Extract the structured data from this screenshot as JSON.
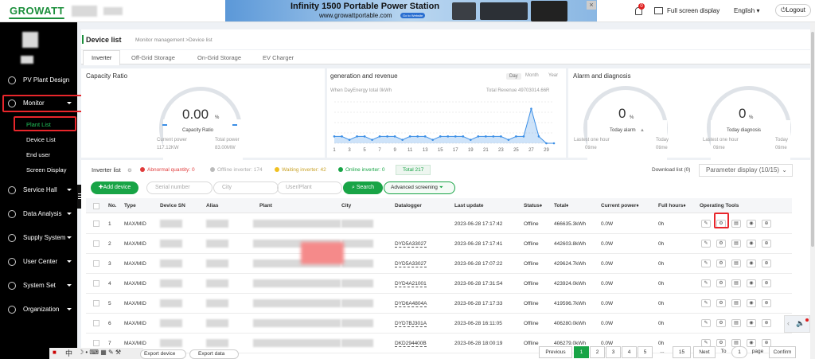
{
  "header": {
    "logo": "GROWATT",
    "ad": {
      "title": "Infinity 1500 Portable Power Station",
      "url": "www.growattportable.com",
      "button": "Go to Website"
    },
    "notification_count": "0",
    "fullscreen_label": "Full screen display",
    "language": "English",
    "logout_label": "Logout"
  },
  "sidebar": {
    "items": [
      {
        "label": "PV Plant Design"
      },
      {
        "label": "Monitor"
      },
      {
        "label": "Service Hall"
      },
      {
        "label": "Data Analysis"
      },
      {
        "label": "Supply System"
      },
      {
        "label": "User Center"
      },
      {
        "label": "System Set"
      },
      {
        "label": "Organization"
      }
    ],
    "monitor_sub": [
      "Plant List",
      "Device List",
      "End user",
      "Screen Display"
    ]
  },
  "page": {
    "title": "Device list",
    "breadcrumb": "Monitor management >Device list",
    "tabs": [
      "Inverter",
      "Off-Grid Storage",
      "On-Grid Storage",
      "EV Charger"
    ]
  },
  "capacity": {
    "title": "Capacity Ratio",
    "value": "0.00",
    "unit": "%",
    "label": "Capacity Ratio",
    "current_power_label": "Current power",
    "current_power_value": "117.12KW",
    "total_power_label": "Total power",
    "total_power_value": "83.00MW"
  },
  "revenue": {
    "title": "generation and revenue",
    "segments": [
      "Day",
      "Month",
      "Year"
    ],
    "subtitle": "When DayEnergy total 0kWh",
    "total_revenue": "Total Revenue 49703014.66R"
  },
  "chart_data": {
    "type": "area",
    "x": [
      1,
      2,
      3,
      4,
      5,
      6,
      7,
      8,
      9,
      10,
      11,
      12,
      13,
      14,
      15,
      16,
      17,
      18,
      19,
      20,
      21,
      22,
      23,
      24,
      25,
      26,
      27,
      28,
      29,
      30
    ],
    "values": [
      2,
      2,
      1,
      2,
      2,
      1,
      2,
      2,
      2,
      1,
      2,
      2,
      2,
      1,
      2,
      2,
      2,
      2,
      1,
      2,
      2,
      2,
      2,
      1,
      2,
      2,
      10,
      2,
      0,
      0
    ],
    "x_tick_labels": [
      "1",
      "3",
      "5",
      "7",
      "9",
      "11",
      "13",
      "15",
      "17",
      "19",
      "21",
      "23",
      "25",
      "27",
      "29"
    ],
    "xlim": [
      1,
      30
    ],
    "ylim": [
      0,
      12
    ],
    "color": "#3a8ee6",
    "grid": true
  },
  "alarm": {
    "title": "Alarm and diagnosis",
    "alarm_value": "0",
    "alarm_unit": "%",
    "alarm_label": "Today alarm",
    "diag_value": "0",
    "diag_unit": "%",
    "diag_label": "Today diagnosis",
    "hour_label": "Lastest one hour",
    "today_label": "Today",
    "time_a": "0time",
    "time_b": "0time",
    "time_c": "0time",
    "time_d": "0time"
  },
  "list": {
    "title": "Inverter list",
    "abnormal": "Abnormal quantity: 0",
    "offline": "Offline inverter: 174",
    "waiting": "Waiting inverter: 42",
    "online": "Online inverter: 0",
    "total": "Total 217",
    "download": "Download list (0)",
    "param_display": "Parameter display",
    "param_count": "(10/15)",
    "add_device": "Add device",
    "serial_placeholder": "Serial number",
    "city_placeholder": "City",
    "user_placeholder": "User/Plant",
    "search": "Search",
    "advanced": "Advanced screening",
    "columns": [
      "No.",
      "Type",
      "Device SN",
      "Alias",
      "Plant",
      "City",
      "Datalogger",
      "Last update",
      "Status",
      "Total",
      "Current power",
      "Full hours",
      "Operating Tools"
    ],
    "rows": [
      {
        "no": "1",
        "type": "MAX/MID",
        "datalogger": "",
        "last_update": "2023-06-28 17:17:42",
        "status": "Offline",
        "total": "466635.3kWh",
        "power": "0.0W",
        "hours": "0h"
      },
      {
        "no": "2",
        "type": "MAX/MID",
        "datalogger": "DYD5A33027",
        "last_update": "2023-06-28 17:17:41",
        "status": "Offline",
        "total": "442603.8kWh",
        "power": "0.0W",
        "hours": "0h"
      },
      {
        "no": "3",
        "type": "MAX/MID",
        "datalogger": "DYD5A33027",
        "last_update": "2023-06-28 17:07:22",
        "status": "Offline",
        "total": "429624.7kWh",
        "power": "0.0W",
        "hours": "0h"
      },
      {
        "no": "4",
        "type": "MAX/MID",
        "datalogger": "DYD4A21001",
        "last_update": "2023-06-28 17:31:54",
        "status": "Offline",
        "total": "423924.0kWh",
        "power": "0.0W",
        "hours": "0h"
      },
      {
        "no": "5",
        "type": "MAX/MID",
        "datalogger": "DYD6A4804A",
        "last_update": "2023-06-28 17:17:33",
        "status": "Offline",
        "total": "419596.7kWh",
        "power": "0.0W",
        "hours": "0h"
      },
      {
        "no": "6",
        "type": "MAX/MID",
        "datalogger": "DYD7BJ301A",
        "last_update": "2023-06-28 16:11:05",
        "status": "Offline",
        "total": "406280.0kWh",
        "power": "0.0W",
        "hours": "0h"
      },
      {
        "no": "7",
        "type": "MAX/MID",
        "datalogger": "DKD294400B",
        "last_update": "2023-06-28 18:00:19",
        "status": "Offline",
        "total": "406279.0kWh",
        "power": "0.0W",
        "hours": "0h"
      }
    ]
  },
  "footer": {
    "export_device": "Export device",
    "export_data": "Export data",
    "previous": "Previous",
    "pages": [
      "1",
      "2",
      "3",
      "4",
      "5",
      "...",
      "15"
    ],
    "next": "Next",
    "to": "To",
    "page_input": "1",
    "page_label": "page",
    "confirm": "Confirm",
    "ime_char": "中"
  }
}
